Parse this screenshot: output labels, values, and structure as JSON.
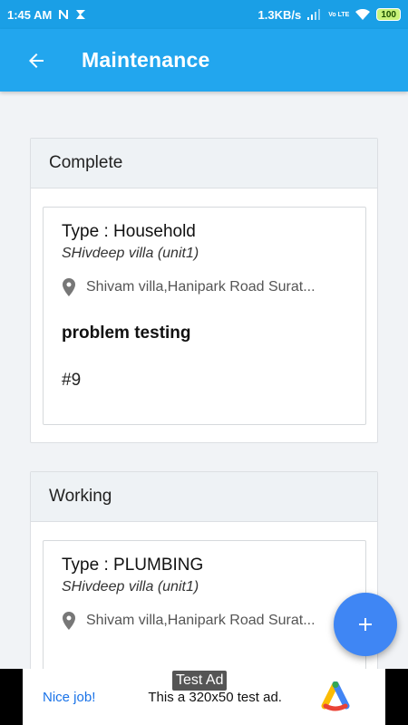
{
  "status_bar": {
    "time": "1:45 AM",
    "network_speed": "1.3KB/s",
    "volte": "Vo LTE",
    "battery": "100",
    "notification_icons": [
      "n-icon",
      "signal-b-icon"
    ]
  },
  "app_bar": {
    "title": "Maintenance",
    "back_icon": "arrow-back-icon"
  },
  "sections": [
    {
      "header": "Complete",
      "items": [
        {
          "type": "Type : Household",
          "property": "SHivdeep villa (unit1)",
          "address": "Shivam villa,Hanipark Road Surat...",
          "problem": "problem testing",
          "number": "#9"
        }
      ]
    },
    {
      "header": "Working",
      "items": [
        {
          "type": "Type : PLUMBING",
          "property": "SHivdeep villa (unit1)",
          "address": "Shivam villa,Hanipark Road Surat..."
        }
      ]
    }
  ],
  "fab": {
    "icon": "plus-icon"
  },
  "ad": {
    "label": "Test Ad",
    "nice": "Nice job!",
    "text": "This a 320x50 test ad."
  },
  "colors": {
    "status_bar": "#1a9fe6",
    "app_bar": "#22a6ee",
    "fab": "#3f86f4",
    "background": "#f1f3f6"
  }
}
